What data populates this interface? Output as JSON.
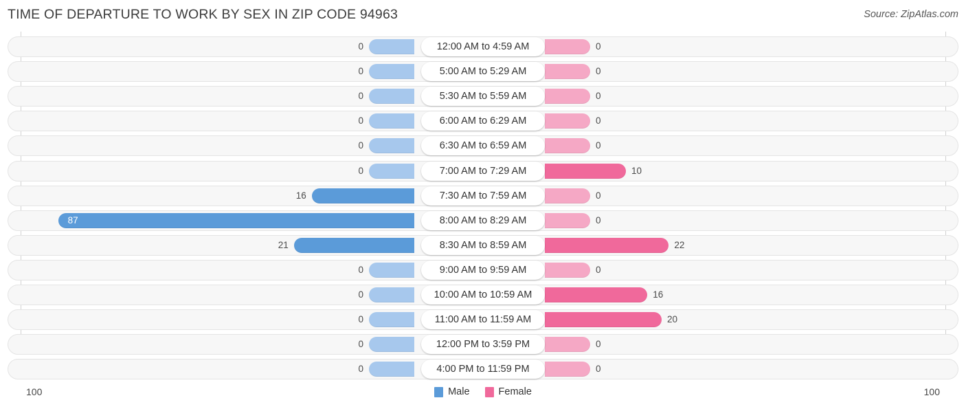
{
  "header": {
    "title": "TIME OF DEPARTURE TO WORK BY SEX IN ZIP CODE 94963",
    "source": "Source: ZipAtlas.com"
  },
  "legend": {
    "male_label": "Male",
    "female_label": "Female",
    "male_color": "#5b9bd9",
    "female_color": "#f0699b"
  },
  "axis": {
    "left_tick": "100",
    "right_tick": "100"
  },
  "colors": {
    "male_light": "#a7c8ed",
    "male_strong": "#5b9bd9",
    "female_light": "#f5a8c5",
    "female_strong": "#f0699b",
    "track": "#f7f7f7",
    "track_border": "#e4e4e4",
    "title_text": "#3c3c3c"
  },
  "chart_data": {
    "type": "bar",
    "orientation": "horizontal-diverging",
    "title": "TIME OF DEPARTURE TO WORK BY SEX IN ZIP CODE 94963",
    "xlabel": "",
    "ylabel": "",
    "xlim": [
      100,
      100
    ],
    "grid": false,
    "legend_position": "bottom-center",
    "categories": [
      "12:00 AM to 4:59 AM",
      "5:00 AM to 5:29 AM",
      "5:30 AM to 5:59 AM",
      "6:00 AM to 6:29 AM",
      "6:30 AM to 6:59 AM",
      "7:00 AM to 7:29 AM",
      "7:30 AM to 7:59 AM",
      "8:00 AM to 8:29 AM",
      "8:30 AM to 8:59 AM",
      "9:00 AM to 9:59 AM",
      "10:00 AM to 10:59 AM",
      "11:00 AM to 11:59 AM",
      "12:00 PM to 3:59 PM",
      "4:00 PM to 11:59 PM"
    ],
    "series": [
      {
        "name": "Male",
        "color": "#5b9bd9",
        "values": [
          0,
          0,
          0,
          0,
          0,
          0,
          16,
          87,
          21,
          0,
          0,
          0,
          0,
          0
        ]
      },
      {
        "name": "Female",
        "color": "#f0699b",
        "values": [
          0,
          0,
          0,
          0,
          0,
          10,
          0,
          0,
          22,
          0,
          16,
          20,
          0,
          0
        ]
      }
    ]
  },
  "rows": [
    {
      "category": "12:00 AM to 4:59 AM",
      "male": "0",
      "female": "0"
    },
    {
      "category": "5:00 AM to 5:29 AM",
      "male": "0",
      "female": "0"
    },
    {
      "category": "5:30 AM to 5:59 AM",
      "male": "0",
      "female": "0"
    },
    {
      "category": "6:00 AM to 6:29 AM",
      "male": "0",
      "female": "0"
    },
    {
      "category": "6:30 AM to 6:59 AM",
      "male": "0",
      "female": "0"
    },
    {
      "category": "7:00 AM to 7:29 AM",
      "male": "0",
      "female": "10"
    },
    {
      "category": "7:30 AM to 7:59 AM",
      "male": "16",
      "female": "0"
    },
    {
      "category": "8:00 AM to 8:29 AM",
      "male": "87",
      "female": "0"
    },
    {
      "category": "8:30 AM to 8:59 AM",
      "male": "21",
      "female": "22"
    },
    {
      "category": "9:00 AM to 9:59 AM",
      "male": "0",
      "female": "0"
    },
    {
      "category": "10:00 AM to 10:59 AM",
      "male": "0",
      "female": "16"
    },
    {
      "category": "11:00 AM to 11:59 AM",
      "male": "0",
      "female": "20"
    },
    {
      "category": "12:00 PM to 3:59 PM",
      "male": "0",
      "female": "0"
    },
    {
      "category": "4:00 PM to 11:59 PM",
      "male": "0",
      "female": "0"
    }
  ]
}
